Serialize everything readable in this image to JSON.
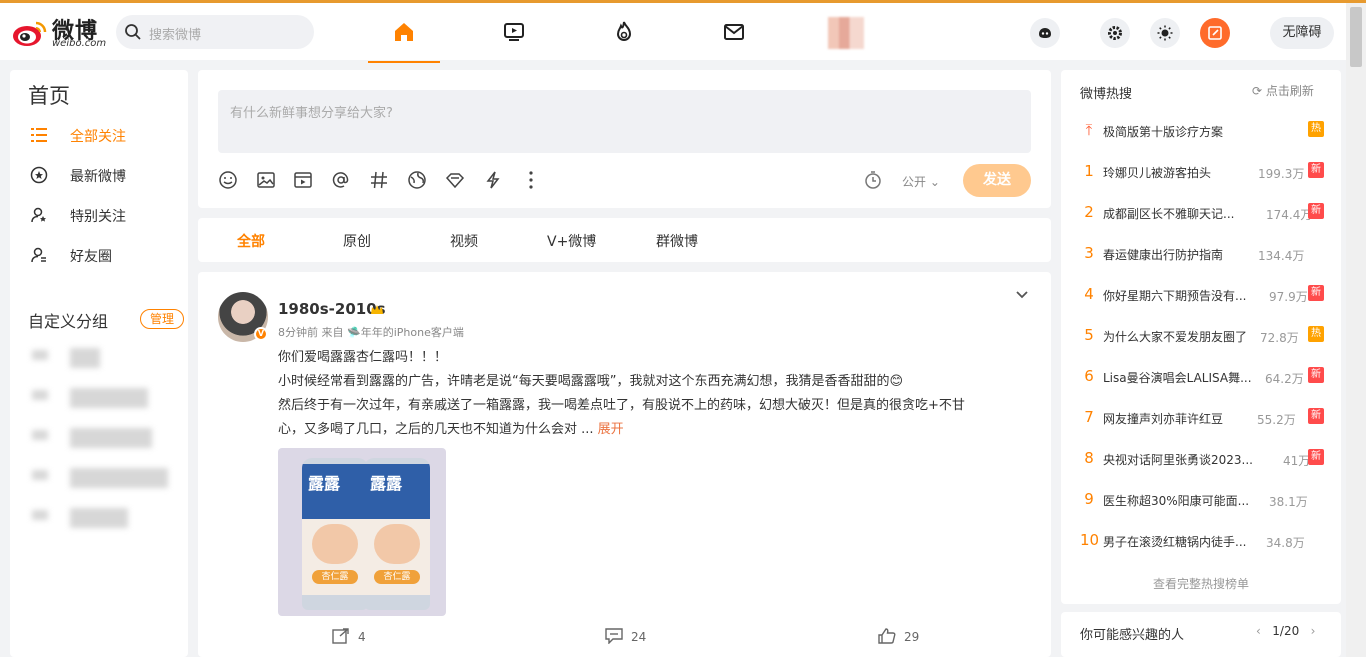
{
  "header": {
    "logo_text": "微博",
    "logo_sub": "weibo.com",
    "search_placeholder": "搜索微博",
    "nav_icons": [
      "home-icon",
      "video-icon",
      "hot-icon",
      "mail-icon"
    ],
    "right_icons": [
      "game-icon",
      "settings-icon",
      "theme-icon",
      "compose-icon"
    ],
    "accessibility_label": "无障碍",
    "accent": "#ff8200"
  },
  "left": {
    "title": "首页",
    "items": [
      {
        "label": "全部关注",
        "icon": "list-icon"
      },
      {
        "label": "最新微博",
        "icon": "latest-icon"
      },
      {
        "label": "特别关注",
        "icon": "special-follow-icon"
      },
      {
        "label": "好友圈",
        "icon": "friends-icon"
      }
    ],
    "group_title": "自定义分组",
    "manage_label": "管理"
  },
  "composer": {
    "placeholder": "有什么新鲜事想分享给大家?",
    "tools": [
      "emoji-icon",
      "image-icon",
      "video-icon",
      "mention-icon",
      "topic-icon",
      "location-icon",
      "super-topic-icon",
      "lightning-icon",
      "more-icon"
    ],
    "visibility": "公开",
    "send_label": "发送"
  },
  "tabs": [
    "全部",
    "原创",
    "视频",
    "V+微博",
    "群微博"
  ],
  "post": {
    "username": "1980s-2010s",
    "time": "8分钟前",
    "from_label": "来自",
    "client": "年年的iPhone客户端",
    "lines": [
      "你们爱喝露露杏仁露吗！！！",
      "小时候经常看到露露的广告，许晴老是说“每天要喝露露哦”，我就对这个东西充满幻想，我猜是香香甜甜的😊",
      "然后终于有一次过年，有亲戚送了一箱露露，我一喝差点吐了，有股说不上的药味，幻想大破灭！但是真的很贪吃+不甘",
      "心，又多喝了几口，之后的几天也不知道为什么会对  ..."
    ],
    "expand_label": "展开",
    "can_text": "露露",
    "can_label": "杏仁露",
    "reposts": "4",
    "comments": "24",
    "likes": "29"
  },
  "right": {
    "title": "微博热搜",
    "refresh_label": "点击刷新",
    "hot": [
      {
        "rank": "",
        "title": "极简版第十版诊疗方案",
        "count": "",
        "badge": "热",
        "badge_type": "hot"
      },
      {
        "rank": "1",
        "title": "玲娜贝儿被游客拍头",
        "count": "199.3万",
        "badge": "新",
        "badge_type": "new"
      },
      {
        "rank": "2",
        "title": "成都副区长不雅聊天记...",
        "count": "174.4万",
        "badge": "新",
        "badge_type": "new"
      },
      {
        "rank": "3",
        "title": "春运健康出行防护指南",
        "count": "134.4万",
        "badge": "",
        "badge_type": ""
      },
      {
        "rank": "4",
        "title": "你好星期六下期预告没有...",
        "count": "97.9万",
        "badge": "新",
        "badge_type": "new"
      },
      {
        "rank": "5",
        "title": "为什么大家不爱发朋友圈了",
        "count": "72.8万",
        "badge": "热",
        "badge_type": "hot"
      },
      {
        "rank": "6",
        "title": "Lisa曼谷演唱会LALISA舞...",
        "count": "64.2万",
        "badge": "新",
        "badge_type": "new"
      },
      {
        "rank": "7",
        "title": "网友撞声刘亦菲许红豆",
        "count": "55.2万",
        "badge": "新",
        "badge_type": "new"
      },
      {
        "rank": "8",
        "title": "央视对话阿里张勇谈2023...",
        "count": "41万",
        "badge": "新",
        "badge_type": "new"
      },
      {
        "rank": "9",
        "title": "医生称超30%阳康可能面...",
        "count": "38.1万",
        "badge": "",
        "badge_type": ""
      },
      {
        "rank": "10",
        "title": "男子在滚烫红糖锅内徒手...",
        "count": "34.8万",
        "badge": "",
        "badge_type": ""
      }
    ],
    "see_all": "查看完整热搜榜单",
    "maybe_title": "你可能感兴趣的人",
    "pager": "1/20"
  }
}
